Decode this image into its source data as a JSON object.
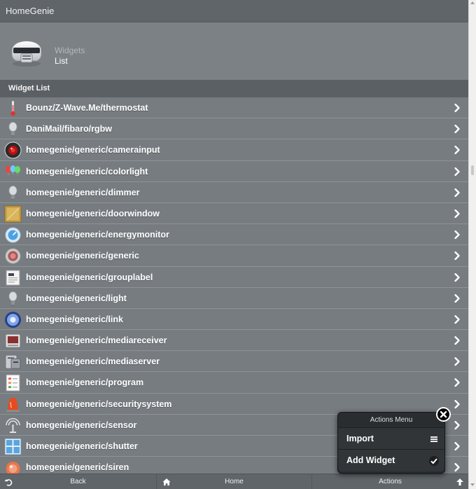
{
  "app": {
    "title": "HomeGenie"
  },
  "header": {
    "subtitle": "Widgets",
    "title": "List",
    "logo_icon": "robot-helmet-logo"
  },
  "section": {
    "label": "Widget List"
  },
  "widgets": [
    {
      "label": "Bounz/Z-Wave.Me/thermostat",
      "icon": "thermometer-icon"
    },
    {
      "label": "DaniMail/fibaro/rgbw",
      "icon": "lightbulb-icon"
    },
    {
      "label": "homegenie/generic/camerainput",
      "icon": "camera-icon"
    },
    {
      "label": "homegenie/generic/colorlight",
      "icon": "color-bulbs-icon"
    },
    {
      "label": "homegenie/generic/dimmer",
      "icon": "lightbulb-icon"
    },
    {
      "label": "homegenie/generic/doorwindow",
      "icon": "door-window-icon"
    },
    {
      "label": "homegenie/generic/energymonitor",
      "icon": "energy-meter-icon"
    },
    {
      "label": "homegenie/generic/generic",
      "icon": "generic-module-icon"
    },
    {
      "label": "homegenie/generic/grouplabel",
      "icon": "group-label-icon"
    },
    {
      "label": "homegenie/generic/light",
      "icon": "lightbulb-icon"
    },
    {
      "label": "homegenie/generic/link",
      "icon": "link-icon"
    },
    {
      "label": "homegenie/generic/mediareceiver",
      "icon": "media-receiver-icon"
    },
    {
      "label": "homegenie/generic/mediaserver",
      "icon": "media-server-icon"
    },
    {
      "label": "homegenie/generic/program",
      "icon": "program-icon"
    },
    {
      "label": "homegenie/generic/securitysystem",
      "icon": "siren-light-icon"
    },
    {
      "label": "homegenie/generic/sensor",
      "icon": "sensor-antenna-icon"
    },
    {
      "label": "homegenie/generic/shutter",
      "icon": "shutter-window-icon"
    },
    {
      "label": "homegenie/generic/siren",
      "icon": "siren-icon"
    }
  ],
  "footer": {
    "back_label": "Back",
    "home_label": "Home",
    "actions_label": "Actions"
  },
  "actions_menu": {
    "title": "Actions Menu",
    "items": [
      {
        "label": "Import",
        "icon": "menu-lines-icon"
      },
      {
        "label": "Add Widget",
        "icon": "checkmark-icon"
      }
    ]
  }
}
